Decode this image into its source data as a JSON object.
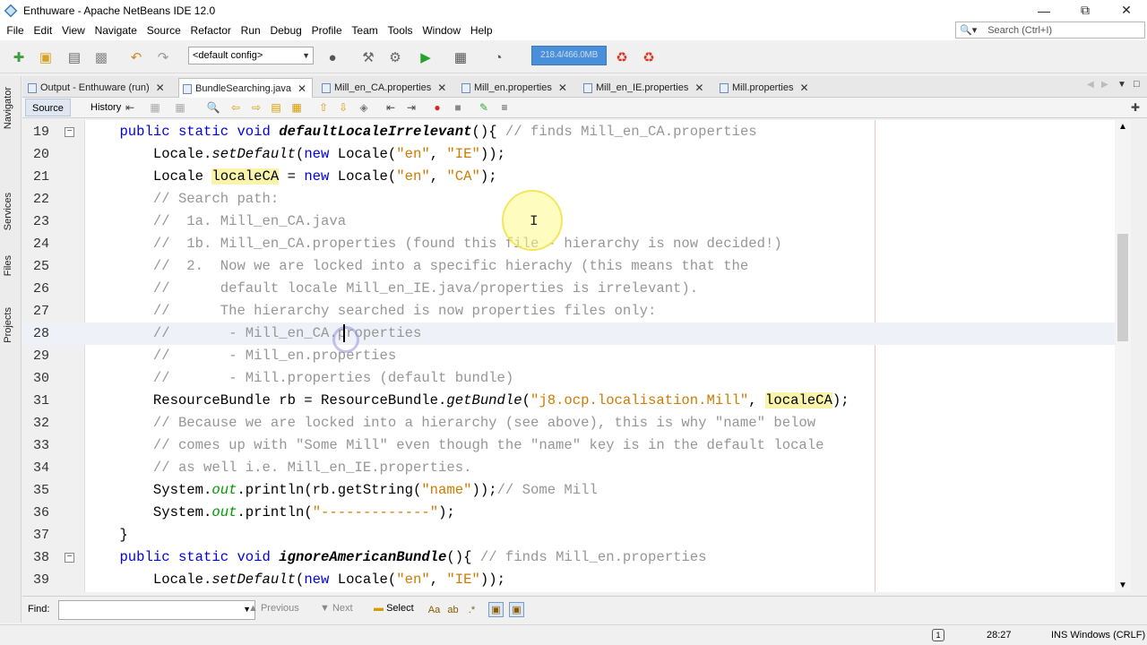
{
  "window": {
    "title": "Enthuware - Apache NetBeans IDE 12.0"
  },
  "menu": [
    "File",
    "Edit",
    "View",
    "Navigate",
    "Source",
    "Refactor",
    "Run",
    "Debug",
    "Profile",
    "Team",
    "Tools",
    "Window",
    "Help"
  ],
  "search": {
    "placeholder": "Search (Ctrl+I)"
  },
  "toolbar": {
    "config": "<default config>",
    "memory": "218.4/466.0MB"
  },
  "sidebar": {
    "tabs": [
      "Navigator",
      "Services",
      "Files",
      "Projects"
    ]
  },
  "tabs": [
    {
      "label": "Output - Enthuware (run)"
    },
    {
      "label": "BundleSearching.java",
      "active": true
    },
    {
      "label": "Mill_en_CA.properties"
    },
    {
      "label": "Mill_en.properties"
    },
    {
      "label": "Mill_en_IE.properties"
    },
    {
      "label": "Mill.properties"
    }
  ],
  "editor_toolbar": {
    "source": "Source",
    "history": "History"
  },
  "code_lines": [
    {
      "n": "19",
      "fold": "−",
      "html": "    <span class=\"kw\">public static void</span> <span class=\"bi\">defaultLocaleIrrelevant</span>(){ <span class=\"cm\">// finds Mill_en_CA.properties</span>"
    },
    {
      "n": "20",
      "html": "        Locale.<span class=\"it\">setDefault</span>(<span class=\"kw\">new</span> Locale(<span class=\"str\">\"en\"</span>, <span class=\"str\">\"IE\"</span>));"
    },
    {
      "n": "21",
      "html": "        Locale <span class=\"hl\">localeCA</span> = <span class=\"kw\">new</span> Locale(<span class=\"str\">\"en\"</span>, <span class=\"str\">\"CA\"</span>);"
    },
    {
      "n": "22",
      "html": "        <span class=\"cm\">// Search path:</span>"
    },
    {
      "n": "23",
      "html": "        <span class=\"cm\">//  1a. Mill_en_CA.java</span>"
    },
    {
      "n": "24",
      "html": "        <span class=\"cm\">//  1b. Mill_en_CA.properties (found this file - hierarchy is now decided!)</span>"
    },
    {
      "n": "25",
      "html": "        <span class=\"cm\">//  2.  Now we are locked into a specific hierachy (this means that the</span>"
    },
    {
      "n": "26",
      "html": "        <span class=\"cm\">//      default locale Mill_en_IE.java/properties is irrelevant).</span>"
    },
    {
      "n": "27",
      "html": "        <span class=\"cm\">//      The hierarchy searched is now properties files only:</span>"
    },
    {
      "n": "28",
      "cur": true,
      "html": "        <span class=\"cm\">//       - Mill_en_CA.properties</span>"
    },
    {
      "n": "29",
      "html": "        <span class=\"cm\">//       - Mill_en.properties</span>"
    },
    {
      "n": "30",
      "html": "        <span class=\"cm\">//       - Mill.properties (default bundle)</span>"
    },
    {
      "n": "31",
      "html": "        ResourceBundle rb = ResourceBundle.<span class=\"it\">getBundle</span>(<span class=\"str\">\"j8.ocp.localisation.Mill\"</span>, <span class=\"hl\">localeCA</span>);"
    },
    {
      "n": "32",
      "html": "        <span class=\"cm\">// Because we are locked into a hierarchy (see above), this is why \"name\" below</span>"
    },
    {
      "n": "33",
      "html": "        <span class=\"cm\">// comes up with \"Some Mill\" even though the \"name\" key is in the default locale</span>"
    },
    {
      "n": "34",
      "html": "        <span class=\"cm\">// as well i.e. Mill_en_IE.properties.</span>"
    },
    {
      "n": "35",
      "html": "        System.<span class=\"out\">out</span>.println(rb.getString(<span class=\"str\">\"name\"</span>));<span class=\"cm\">// Some Mill</span>"
    },
    {
      "n": "36",
      "html": "        System.<span class=\"out\">out</span>.println(<span class=\"str\">\"-------------\"</span>);"
    },
    {
      "n": "37",
      "html": "    }"
    },
    {
      "n": "38",
      "fold": "−",
      "html": "    <span class=\"kw\">public static void</span> <span class=\"bi\">ignoreAmericanBundle</span>(){ <span class=\"cm\">// finds Mill_en.properties</span>"
    },
    {
      "n": "39",
      "html": "        Locale.<span class=\"it\">setDefault</span>(<span class=\"kw\">new</span> Locale(<span class=\"str\">\"en\"</span>, <span class=\"str\">\"IE\"</span>));"
    }
  ],
  "findbar": {
    "label": "Find:",
    "previous": "Previous",
    "next": "Next",
    "select": "Select"
  },
  "status": {
    "position": "28:27",
    "mode": "INS Windows (CRLF)",
    "notifications": "1"
  },
  "icons": [
    "app-icon",
    "search-icon",
    "new-project-icon",
    "open-project-icon",
    "save-all-icon",
    "undo-icon",
    "redo-icon",
    "build-icon",
    "clean-build-icon",
    "run-icon",
    "debug-icon",
    "profile-icon"
  ]
}
